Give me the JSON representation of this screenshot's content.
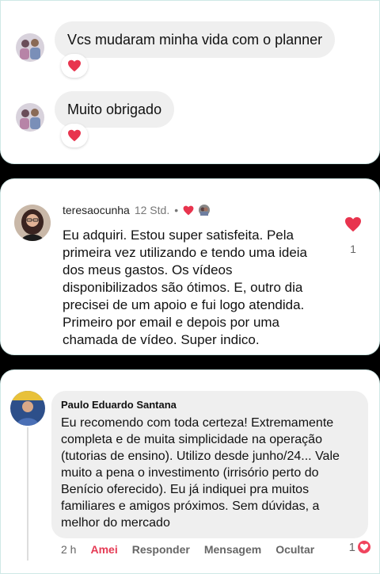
{
  "reply1": {
    "text": "Vcs mudaram minha vida com o planner",
    "reaction": "heart-icon"
  },
  "reply2": {
    "text": "Muito obrigado",
    "reaction": "heart-icon"
  },
  "comment1": {
    "username": "teresaocunha",
    "time": "12 Std.",
    "separator": "•",
    "text": "Eu adquiri. Estou super satisfeita. Pela primeira vez utilizando e tendo uma ideia dos meus gastos. Os vídeos disponibilizados são ótimos. E, outro dia precisei de um apoio e fui logo atendida. Primeiro por email e depois por uma chamada de vídeo. Super indico.",
    "like_count": "1"
  },
  "comment2": {
    "author": "Paulo Eduardo Santana",
    "text": "Eu recomendo com toda certeza! Extremamente completa e de muita simplicidade na operação (tutorias de ensino). Utilizo desde junho/24...  Vale muito a pena o investimento (irrisório perto do Benício oferecido). Eu já indiquei pra muitos familiares e amigos próximos. Sem dúvidas, a melhor do mercado",
    "actions": {
      "time": "2 h",
      "liked": "Amei",
      "reply": "Responder",
      "message": "Mensagem",
      "hide": "Ocultar"
    },
    "reaction_count": "1"
  },
  "colors": {
    "heart": "#e8344e",
    "background": "#000000",
    "card": "#ffffff",
    "bubble": "#efefef"
  }
}
